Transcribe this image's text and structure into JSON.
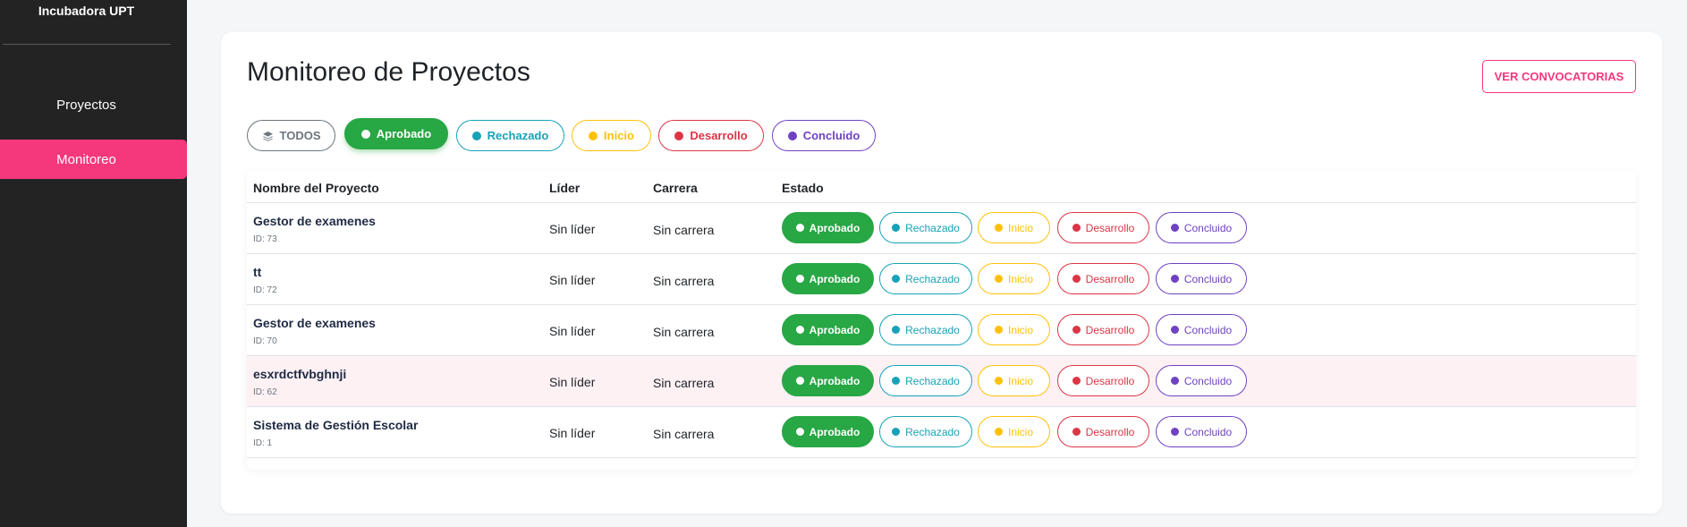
{
  "sidebar": {
    "brand": "Incubadora UPT",
    "items": [
      {
        "label": "Proyectos",
        "active": false
      },
      {
        "label": "Monitoreo",
        "active": true
      }
    ]
  },
  "header": {
    "title": "Monitoreo de Proyectos",
    "convocatorias_label": "VER CONVOCATORIAS"
  },
  "filters": {
    "todos": "TODOS",
    "aprobado": "Aprobado",
    "rechazado": "Rechazado",
    "inicio": "Inicio",
    "desarrollo": "Desarrollo",
    "concluido": "Concluido",
    "selected": "Aprobado",
    "todos_icon": "layers-icon"
  },
  "table": {
    "headers": [
      "Nombre del Proyecto",
      "Líder",
      "Carrera",
      "Estado"
    ],
    "rows": [
      {
        "name": "Gestor de examenes",
        "id": "ID: 73",
        "lider": "Sin líder",
        "carrera": "Sin carrera",
        "estado": "Aprobado"
      },
      {
        "name": "tt",
        "id": "ID: 72",
        "lider": "Sin líder",
        "carrera": "Sin carrera",
        "estado": "Aprobado"
      },
      {
        "name": "Gestor de examenes",
        "id": "ID: 70",
        "lider": "Sin líder",
        "carrera": "Sin carrera",
        "estado": "Aprobado"
      },
      {
        "name": "esxrdctfvbghnji",
        "id": "ID: 62",
        "lider": "Sin líder",
        "carrera": "Sin carrera",
        "estado": "Aprobado"
      },
      {
        "name": "Sistema de Gestión Escolar",
        "id": "ID: 1",
        "lider": "Sin líder",
        "carrera": "Sin carrera",
        "estado": "Aprobado"
      }
    ],
    "status_labels": {
      "aprobado": "Aprobado",
      "rechazado": "Rechazado",
      "inicio": "Inicio",
      "desarrollo": "Desarrollo",
      "concluido": "Concluido"
    }
  },
  "colors": {
    "accent": "#f5377b",
    "sidebar": "#232323",
    "aprobado": "#28a745",
    "rechazado": "#17a2b8",
    "inicio": "#ffc107",
    "desarrollo": "#dc3545",
    "concluido": "#6f42c1"
  }
}
